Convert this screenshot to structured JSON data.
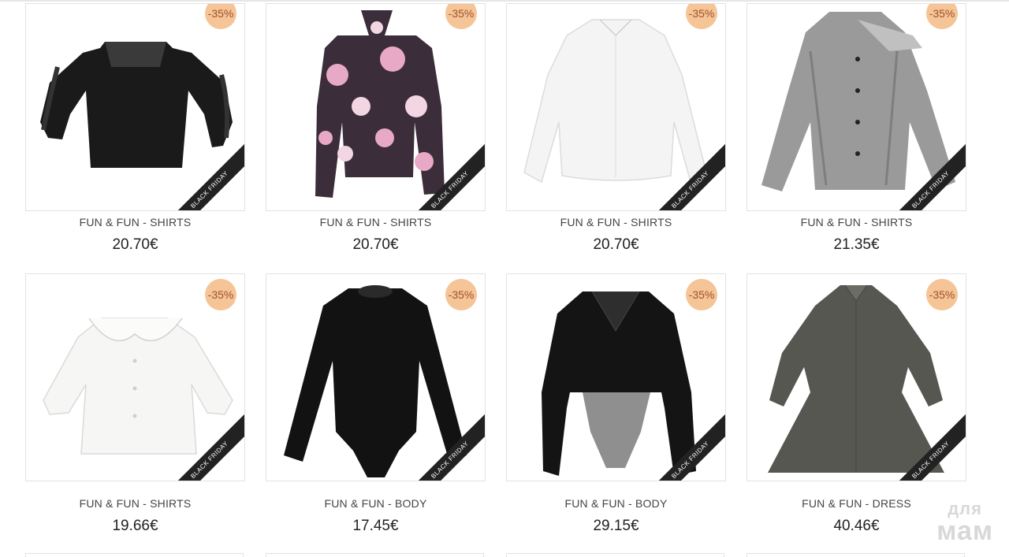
{
  "products": [
    {
      "title": "FUN & FUN - SHIRTS",
      "price": "20.70€",
      "discount": "-35%",
      "ribbon": "BLACK FRIDAY",
      "image": "black-ruffle-sleeve-top"
    },
    {
      "title": "FUN & FUN - SHIRTS",
      "price": "20.70€",
      "discount": "-35%",
      "ribbon": "BLACK FRIDAY",
      "image": "polka-dot-bow-blouse"
    },
    {
      "title": "FUN & FUN - SHIRTS",
      "price": "20.70€",
      "discount": "-35%",
      "ribbon": "BLACK FRIDAY",
      "image": "white-shirt"
    },
    {
      "title": "FUN & FUN - SHIRTS",
      "price": "21.35€",
      "discount": "-35%",
      "ribbon": "BLACK FRIDAY",
      "image": "silver-bow-blouse"
    },
    {
      "title": "FUN & FUN - SHIRTS",
      "price": "19.66€",
      "discount": "-35%",
      "ribbon": "BLACK FRIDAY",
      "image": "white-collar-blouse"
    },
    {
      "title": "FUN & FUN - BODY",
      "price": "17.45€",
      "discount": "-35%",
      "ribbon": "BLACK FRIDAY",
      "image": "black-long-sleeve-body"
    },
    {
      "title": "FUN & FUN - BODY",
      "price": "29.15€",
      "discount": "-35%",
      "ribbon": "BLACK FRIDAY",
      "image": "black-collar-body"
    },
    {
      "title": "FUN & FUN - DRESS",
      "price": "40.46€",
      "discount": "-35%",
      "ribbon": "BLACK FRIDAY",
      "image": "grey-shirt-dress"
    }
  ],
  "watermark": {
    "line1": "для",
    "line2": "мам"
  },
  "colors": {
    "discount_bg": "#f5c497",
    "discount_text": "#a0522d",
    "ribbon_bg": "#222222",
    "border": "#e2e2e2"
  }
}
